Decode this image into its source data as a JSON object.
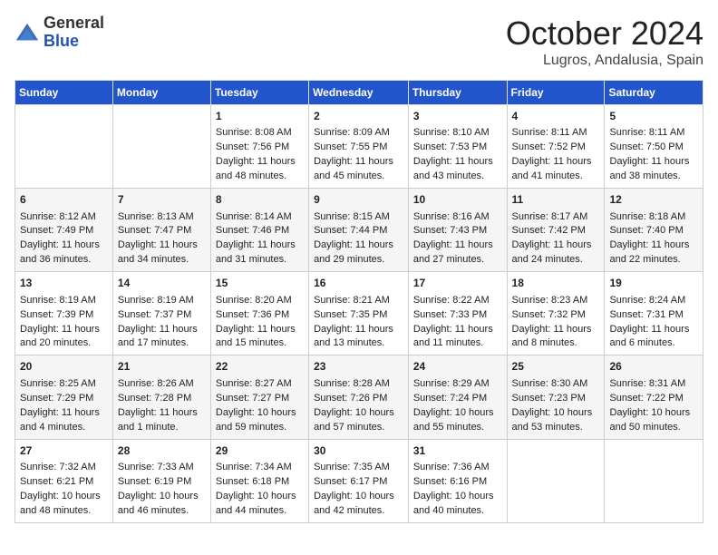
{
  "header": {
    "logo_general": "General",
    "logo_blue": "Blue",
    "month_title": "October 2024",
    "location": "Lugros, Andalusia, Spain"
  },
  "days_of_week": [
    "Sunday",
    "Monday",
    "Tuesday",
    "Wednesday",
    "Thursday",
    "Friday",
    "Saturday"
  ],
  "weeks": [
    [
      {
        "day": "",
        "content": ""
      },
      {
        "day": "",
        "content": ""
      },
      {
        "day": "1",
        "content": "Sunrise: 8:08 AM\nSunset: 7:56 PM\nDaylight: 11 hours and 48 minutes."
      },
      {
        "day": "2",
        "content": "Sunrise: 8:09 AM\nSunset: 7:55 PM\nDaylight: 11 hours and 45 minutes."
      },
      {
        "day": "3",
        "content": "Sunrise: 8:10 AM\nSunset: 7:53 PM\nDaylight: 11 hours and 43 minutes."
      },
      {
        "day": "4",
        "content": "Sunrise: 8:11 AM\nSunset: 7:52 PM\nDaylight: 11 hours and 41 minutes."
      },
      {
        "day": "5",
        "content": "Sunrise: 8:11 AM\nSunset: 7:50 PM\nDaylight: 11 hours and 38 minutes."
      }
    ],
    [
      {
        "day": "6",
        "content": "Sunrise: 8:12 AM\nSunset: 7:49 PM\nDaylight: 11 hours and 36 minutes."
      },
      {
        "day": "7",
        "content": "Sunrise: 8:13 AM\nSunset: 7:47 PM\nDaylight: 11 hours and 34 minutes."
      },
      {
        "day": "8",
        "content": "Sunrise: 8:14 AM\nSunset: 7:46 PM\nDaylight: 11 hours and 31 minutes."
      },
      {
        "day": "9",
        "content": "Sunrise: 8:15 AM\nSunset: 7:44 PM\nDaylight: 11 hours and 29 minutes."
      },
      {
        "day": "10",
        "content": "Sunrise: 8:16 AM\nSunset: 7:43 PM\nDaylight: 11 hours and 27 minutes."
      },
      {
        "day": "11",
        "content": "Sunrise: 8:17 AM\nSunset: 7:42 PM\nDaylight: 11 hours and 24 minutes."
      },
      {
        "day": "12",
        "content": "Sunrise: 8:18 AM\nSunset: 7:40 PM\nDaylight: 11 hours and 22 minutes."
      }
    ],
    [
      {
        "day": "13",
        "content": "Sunrise: 8:19 AM\nSunset: 7:39 PM\nDaylight: 11 hours and 20 minutes."
      },
      {
        "day": "14",
        "content": "Sunrise: 8:19 AM\nSunset: 7:37 PM\nDaylight: 11 hours and 17 minutes."
      },
      {
        "day": "15",
        "content": "Sunrise: 8:20 AM\nSunset: 7:36 PM\nDaylight: 11 hours and 15 minutes."
      },
      {
        "day": "16",
        "content": "Sunrise: 8:21 AM\nSunset: 7:35 PM\nDaylight: 11 hours and 13 minutes."
      },
      {
        "day": "17",
        "content": "Sunrise: 8:22 AM\nSunset: 7:33 PM\nDaylight: 11 hours and 11 minutes."
      },
      {
        "day": "18",
        "content": "Sunrise: 8:23 AM\nSunset: 7:32 PM\nDaylight: 11 hours and 8 minutes."
      },
      {
        "day": "19",
        "content": "Sunrise: 8:24 AM\nSunset: 7:31 PM\nDaylight: 11 hours and 6 minutes."
      }
    ],
    [
      {
        "day": "20",
        "content": "Sunrise: 8:25 AM\nSunset: 7:29 PM\nDaylight: 11 hours and 4 minutes."
      },
      {
        "day": "21",
        "content": "Sunrise: 8:26 AM\nSunset: 7:28 PM\nDaylight: 11 hours and 1 minute."
      },
      {
        "day": "22",
        "content": "Sunrise: 8:27 AM\nSunset: 7:27 PM\nDaylight: 10 hours and 59 minutes."
      },
      {
        "day": "23",
        "content": "Sunrise: 8:28 AM\nSunset: 7:26 PM\nDaylight: 10 hours and 57 minutes."
      },
      {
        "day": "24",
        "content": "Sunrise: 8:29 AM\nSunset: 7:24 PM\nDaylight: 10 hours and 55 minutes."
      },
      {
        "day": "25",
        "content": "Sunrise: 8:30 AM\nSunset: 7:23 PM\nDaylight: 10 hours and 53 minutes."
      },
      {
        "day": "26",
        "content": "Sunrise: 8:31 AM\nSunset: 7:22 PM\nDaylight: 10 hours and 50 minutes."
      }
    ],
    [
      {
        "day": "27",
        "content": "Sunrise: 7:32 AM\nSunset: 6:21 PM\nDaylight: 10 hours and 48 minutes."
      },
      {
        "day": "28",
        "content": "Sunrise: 7:33 AM\nSunset: 6:19 PM\nDaylight: 10 hours and 46 minutes."
      },
      {
        "day": "29",
        "content": "Sunrise: 7:34 AM\nSunset: 6:18 PM\nDaylight: 10 hours and 44 minutes."
      },
      {
        "day": "30",
        "content": "Sunrise: 7:35 AM\nSunset: 6:17 PM\nDaylight: 10 hours and 42 minutes."
      },
      {
        "day": "31",
        "content": "Sunrise: 7:36 AM\nSunset: 6:16 PM\nDaylight: 10 hours and 40 minutes."
      },
      {
        "day": "",
        "content": ""
      },
      {
        "day": "",
        "content": ""
      }
    ]
  ]
}
